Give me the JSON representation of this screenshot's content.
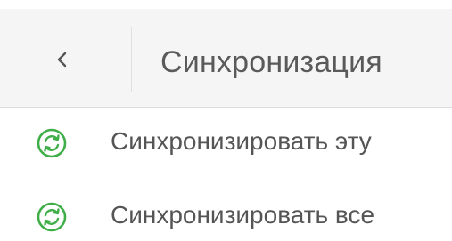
{
  "header": {
    "title": "Синхронизация",
    "back_icon": "chevron-left-icon"
  },
  "menu": {
    "items": [
      {
        "label": "Синхронизировать эту",
        "icon": "sync-icon"
      },
      {
        "label": "Синхронизировать все",
        "icon": "sync-icon"
      }
    ]
  },
  "colors": {
    "header_bg": "#f5f5f5",
    "icon_accent": "#3fae49",
    "text": "#555555"
  }
}
